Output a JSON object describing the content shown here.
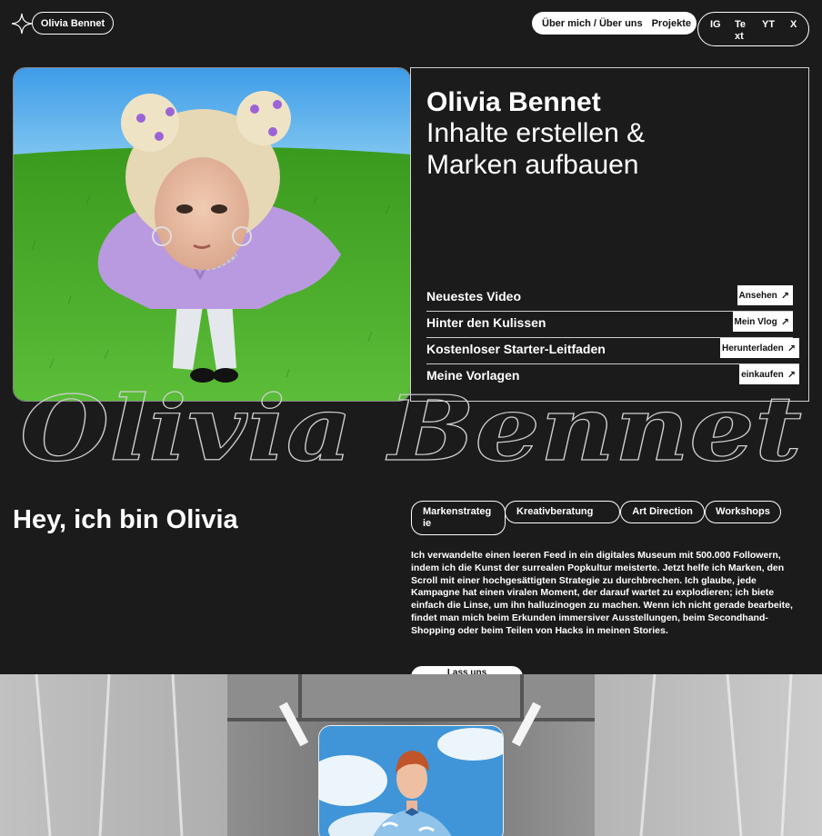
{
  "header": {
    "logo_icon": "sparkle-star-icon",
    "logo_label": "Olivia Bennet",
    "nav": {
      "about_label": "Über mich / Über uns",
      "projects_label": "Projekte"
    },
    "social": {
      "ig": "IG",
      "text_line1": "Te",
      "text_line2": "xt",
      "yt": "YT",
      "x": "X"
    }
  },
  "hero": {
    "name": "Olivia Bennet",
    "tagline_line1": "Inhalte erstellen &",
    "tagline_line2": "Marken aufbauen",
    "links": [
      {
        "label": "Neuestes Video",
        "button": "Ansehen"
      },
      {
        "label": "Hinter den Kulissen",
        "button": "Mein Vlog"
      },
      {
        "label": "Kostenloser Starter-Leitfaden",
        "button": "Herunterladen"
      },
      {
        "label": "Meine Vorlagen",
        "button": "einkaufen"
      }
    ],
    "arrow_icon": "arrow-up-right-icon"
  },
  "script_title": "Olivia Bennet",
  "about": {
    "title": "Hey, ich bin Olivia",
    "chips": {
      "chip1_line1": "Markenstrateg",
      "chip1_line2": "ie",
      "chip2": "Kreativberatung",
      "chip3": "Art Direction",
      "chip4": "Workshops"
    },
    "bio": "Ich verwandelte einen leeren Feed in ein digitales Museum mit 500.000 Followern, indem ich die Kunst der surrealen Popkultur meisterte. Jetzt helfe ich Marken, den Scroll mit einer hochgesättigten Strategie zu durchbrechen. Ich glaube, jede Kampagne hat einen viralen Moment, der darauf wartet zu explodieren; ich biete einfach die Linse, um ihn halluzinogen zu machen. Wenn ich nicht gerade bearbeite, findet man mich beim Erkunden immersiver Ausstellungen, beim Secondhand-Shopping oder beim Teilen von Hacks in meinen Stories.",
    "cta": "Lass uns"
  },
  "colors": {
    "background": "#1b1b1b",
    "text": "#ffffff",
    "sky": "#4aa3e8",
    "grass": "#3c9a22",
    "jacket": "#b99ae0"
  }
}
